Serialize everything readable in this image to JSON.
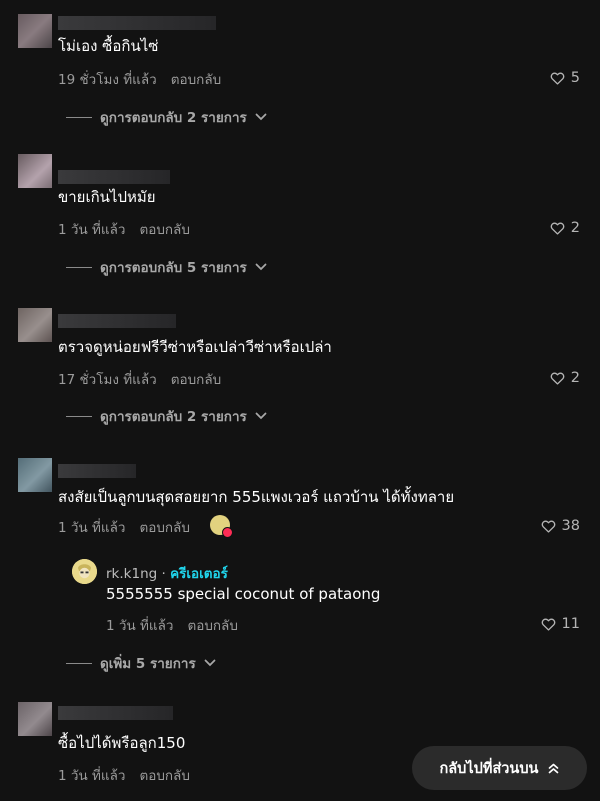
{
  "comments": [
    {
      "text": "โม่เอง ซื้อกินไซ่",
      "time": "19 ชั่วโมง ที่แล้ว",
      "reply": "ตอบกลับ",
      "likes": "5",
      "view_replies": "ดูการตอบกลับ 2 รายการ"
    },
    {
      "text": "ขายเกินไปหมัย",
      "time": "1 วัน ที่แล้ว",
      "reply": "ตอบกลับ",
      "likes": "2",
      "view_replies": "ดูการตอบกลับ 5 รายการ"
    },
    {
      "text": "ตรวจดูหน่อยฟรีวีซ่าหรือเปล่าวีซ่าหรือเปล่า",
      "time": "17 ชั่วโมง ที่แล้ว",
      "reply": "ตอบกลับ",
      "likes": "2",
      "view_replies": "ดูการตอบกลับ 2 รายการ"
    },
    {
      "text": "สงสัยเป็นลูกบนสุดสอยยาก 555แพงเวอร์ แถวบ้าน ได้ทั้งทลาย",
      "time": "1 วัน ที่แล้ว",
      "reply": "ตอบกลับ",
      "likes": "38",
      "creator_reply": {
        "username": "rk.k1ng",
        "separator": "·",
        "badge": "ครีเอเตอร์",
        "text": "5555555 special coconut of pataong",
        "time": "1 วัน ที่แล้ว",
        "reply": "ตอบกลับ",
        "likes": "11"
      },
      "view_more": "ดูเพิ่ม 5 รายการ"
    },
    {
      "text": "ซื้อไปได้พรือลูก150",
      "time": "1 วัน ที่แล้ว",
      "reply": "ตอบกลับ"
    }
  ],
  "back_to_top": "กลับไปที่ส่วนบน",
  "icons": {
    "like": "heart-outline-icon",
    "expand": "chevron-down-icon",
    "back_to_top": "double-chevron-up-icon"
  },
  "colors": {
    "background": "#121212",
    "creator_badge": "#20d5ec",
    "liked_heart": "#fe2c55"
  }
}
